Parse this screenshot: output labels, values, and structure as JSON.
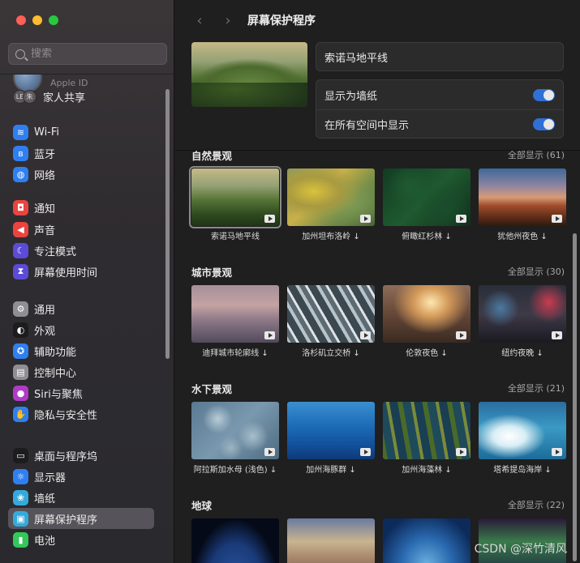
{
  "search": {
    "placeholder": "搜索"
  },
  "apple_id": {
    "label": "Apple ID"
  },
  "family": {
    "avatars": [
      "LE",
      "朱"
    ],
    "label": "家人共享"
  },
  "sidebar": {
    "items": [
      {
        "label": "Wi-Fi",
        "icon": "wifi-icon",
        "color": "#2f7ff0",
        "glyph": "≋"
      },
      {
        "label": "蓝牙",
        "icon": "bluetooth-icon",
        "color": "#2f7ff0",
        "glyph": "ʙ"
      },
      {
        "label": "网络",
        "icon": "globe-icon",
        "color": "#2f7ff0",
        "glyph": "◍"
      },
      {
        "label": "通知",
        "icon": "bell-icon",
        "color": "#e9443f",
        "glyph": "◘"
      },
      {
        "label": "声音",
        "icon": "speaker-icon",
        "color": "#e9443f",
        "glyph": "◀"
      },
      {
        "label": "专注模式",
        "icon": "moon-icon",
        "color": "#5b4bd6",
        "glyph": "☾"
      },
      {
        "label": "屏幕使用时间",
        "icon": "hourglass-icon",
        "color": "#5b4bd6",
        "glyph": "⧗"
      },
      {
        "label": "通用",
        "icon": "gear-icon",
        "color": "#8e8e93",
        "glyph": "⚙"
      },
      {
        "label": "外观",
        "icon": "appearance-icon",
        "color": "#1c1c1e",
        "glyph": "◐"
      },
      {
        "label": "辅助功能",
        "icon": "accessibility-icon",
        "color": "#2f7ff0",
        "glyph": "✪"
      },
      {
        "label": "控制中心",
        "icon": "control-center-icon",
        "color": "#8e8e93",
        "glyph": "▤"
      },
      {
        "label": "Siri与聚焦",
        "icon": "siri-icon",
        "color": "#b03ac8",
        "glyph": "●"
      },
      {
        "label": "隐私与安全性",
        "icon": "hand-icon",
        "color": "#2f7ff0",
        "glyph": "✋"
      },
      {
        "label": "桌面与程序坞",
        "icon": "dock-icon",
        "color": "#1c1c1e",
        "glyph": "▭"
      },
      {
        "label": "显示器",
        "icon": "display-icon",
        "color": "#2f7ff0",
        "glyph": "☼"
      },
      {
        "label": "墙纸",
        "icon": "wallpaper-icon",
        "color": "#34aadc",
        "glyph": "❀"
      },
      {
        "label": "屏幕保护程序",
        "icon": "screensaver-icon",
        "color": "#34aadc",
        "glyph": "▣",
        "active": true
      },
      {
        "label": "电池",
        "icon": "battery-icon",
        "color": "#34c759",
        "glyph": "▮"
      }
    ]
  },
  "toolbar": {
    "title": "屏幕保护程序",
    "back_icon": "chevron-left-icon",
    "forward_icon": "chevron-right-icon"
  },
  "header": {
    "selected_name": "索诺马地平线",
    "options": [
      {
        "label": "显示为墙纸",
        "on": true
      },
      {
        "label": "在所有空间中显示",
        "on": true
      }
    ]
  },
  "sections": [
    {
      "title": "自然景观",
      "show_all": "全部显示 (61)",
      "items": [
        {
          "caption": "索诺马地平线",
          "selected": true
        },
        {
          "caption": "加州坦布洛岭 ↓"
        },
        {
          "caption": "俯瞰红杉林 ↓"
        },
        {
          "caption": "犹他州夜色 ↓"
        }
      ]
    },
    {
      "title": "城市景观",
      "show_all": "全部显示 (30)",
      "items": [
        {
          "caption": "迪拜城市轮廓线 ↓"
        },
        {
          "caption": "洛杉矶立交桥 ↓"
        },
        {
          "caption": "伦敦夜色 ↓"
        },
        {
          "caption": "纽约夜晚 ↓"
        }
      ]
    },
    {
      "title": "水下景观",
      "show_all": "全部显示 (21)",
      "items": [
        {
          "caption": "阿拉斯加水母 (浅色) ↓"
        },
        {
          "caption": "加州海豚群 ↓"
        },
        {
          "caption": "加州海藻林 ↓"
        },
        {
          "caption": "塔希提岛海岸 ↓"
        }
      ]
    },
    {
      "title": "地球",
      "show_all": "全部显示 (22)",
      "items": [
        {
          "caption": ""
        },
        {
          "caption": ""
        },
        {
          "caption": ""
        },
        {
          "caption": ""
        }
      ]
    }
  ],
  "watermark": "CSDN @深竹清风"
}
